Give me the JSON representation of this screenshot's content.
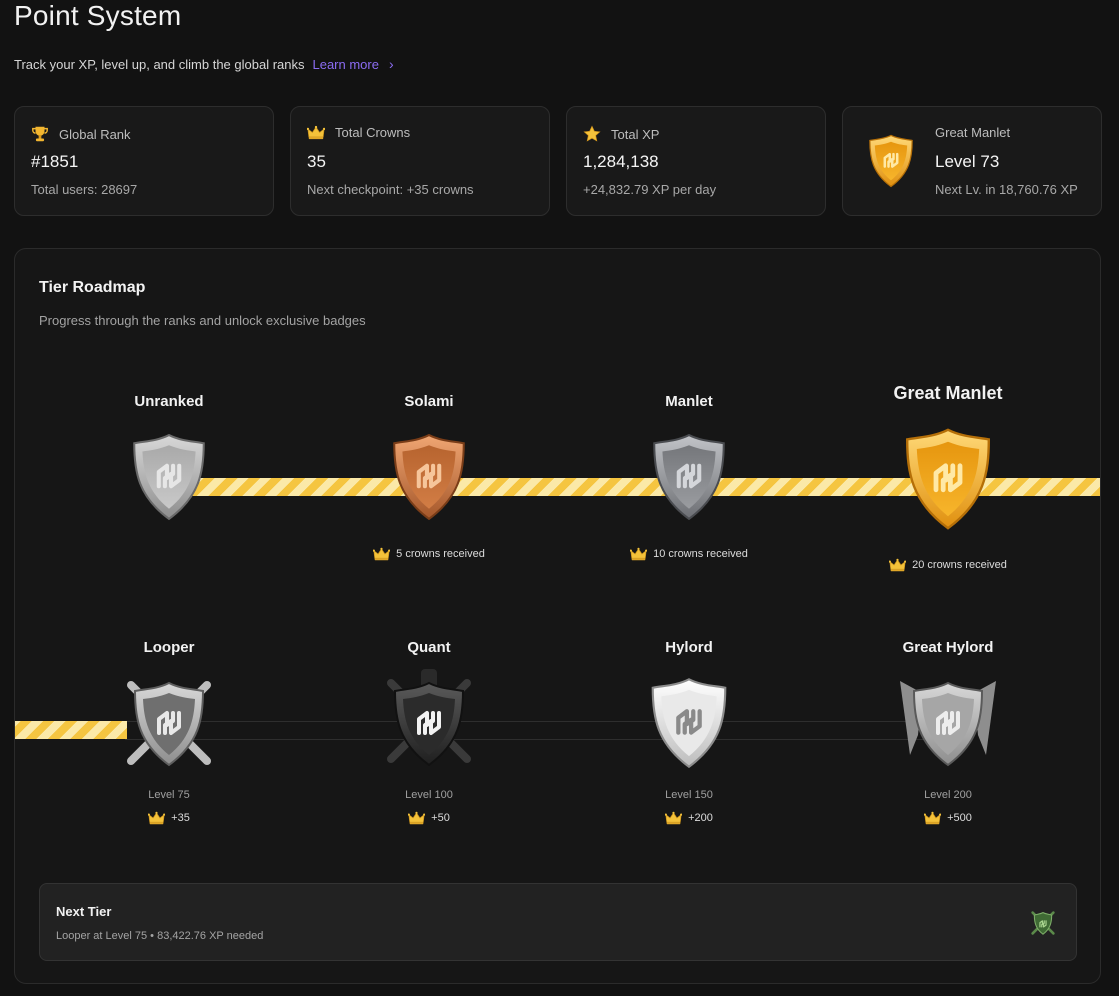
{
  "header": {
    "title": "Point System",
    "subtitle": "Track your XP, level up, and climb the global ranks",
    "learn_more": "Learn more"
  },
  "stats": {
    "global_rank": {
      "label": "Global Rank",
      "value": "#1851",
      "sub": "Total users: 28697",
      "icon": "trophy-icon"
    },
    "total_crowns": {
      "label": "Total Crowns",
      "value": "35",
      "sub": "Next checkpoint: +35 crowns",
      "icon": "crown-icon"
    },
    "total_xp": {
      "label": "Total XP",
      "value": "1,284,138",
      "sub": "+24,832.79 XP per day",
      "icon": "star-icon"
    },
    "current_rank": {
      "label": "Great Manlet",
      "value": "Level 73",
      "sub": "Next Lv. in 18,760.76 XP",
      "icon": "gold-shield-icon"
    }
  },
  "roadmap": {
    "title": "Tier Roadmap",
    "subtitle": "Progress through the ranks and unlock exclusive badges",
    "row1": [
      {
        "name": "Unranked",
        "req": ""
      },
      {
        "name": "Solami",
        "req": "5 crowns received"
      },
      {
        "name": "Manlet",
        "req": "10 crowns received"
      },
      {
        "name": "Great Manlet",
        "req": "20 crowns received"
      }
    ],
    "row2": [
      {
        "name": "Looper",
        "level": "Level 75",
        "crowns": "+35"
      },
      {
        "name": "Quant",
        "level": "Level 100",
        "crowns": "+50"
      },
      {
        "name": "Hylord",
        "level": "Level 150",
        "crowns": "+200"
      },
      {
        "name": "Great Hylord",
        "level": "Level 200",
        "crowns": "+500"
      }
    ],
    "current_tier_index": 3
  },
  "next_tier": {
    "title": "Next Tier",
    "desc": "Looper at Level 75 • 83,422.76 XP needed"
  },
  "colors": {
    "accent": "#8b6cf2",
    "stripe_yellow": "#f5c540",
    "gold": "#f2a91e",
    "bronze": "#c9743a",
    "silver": "#9a9a9a"
  }
}
